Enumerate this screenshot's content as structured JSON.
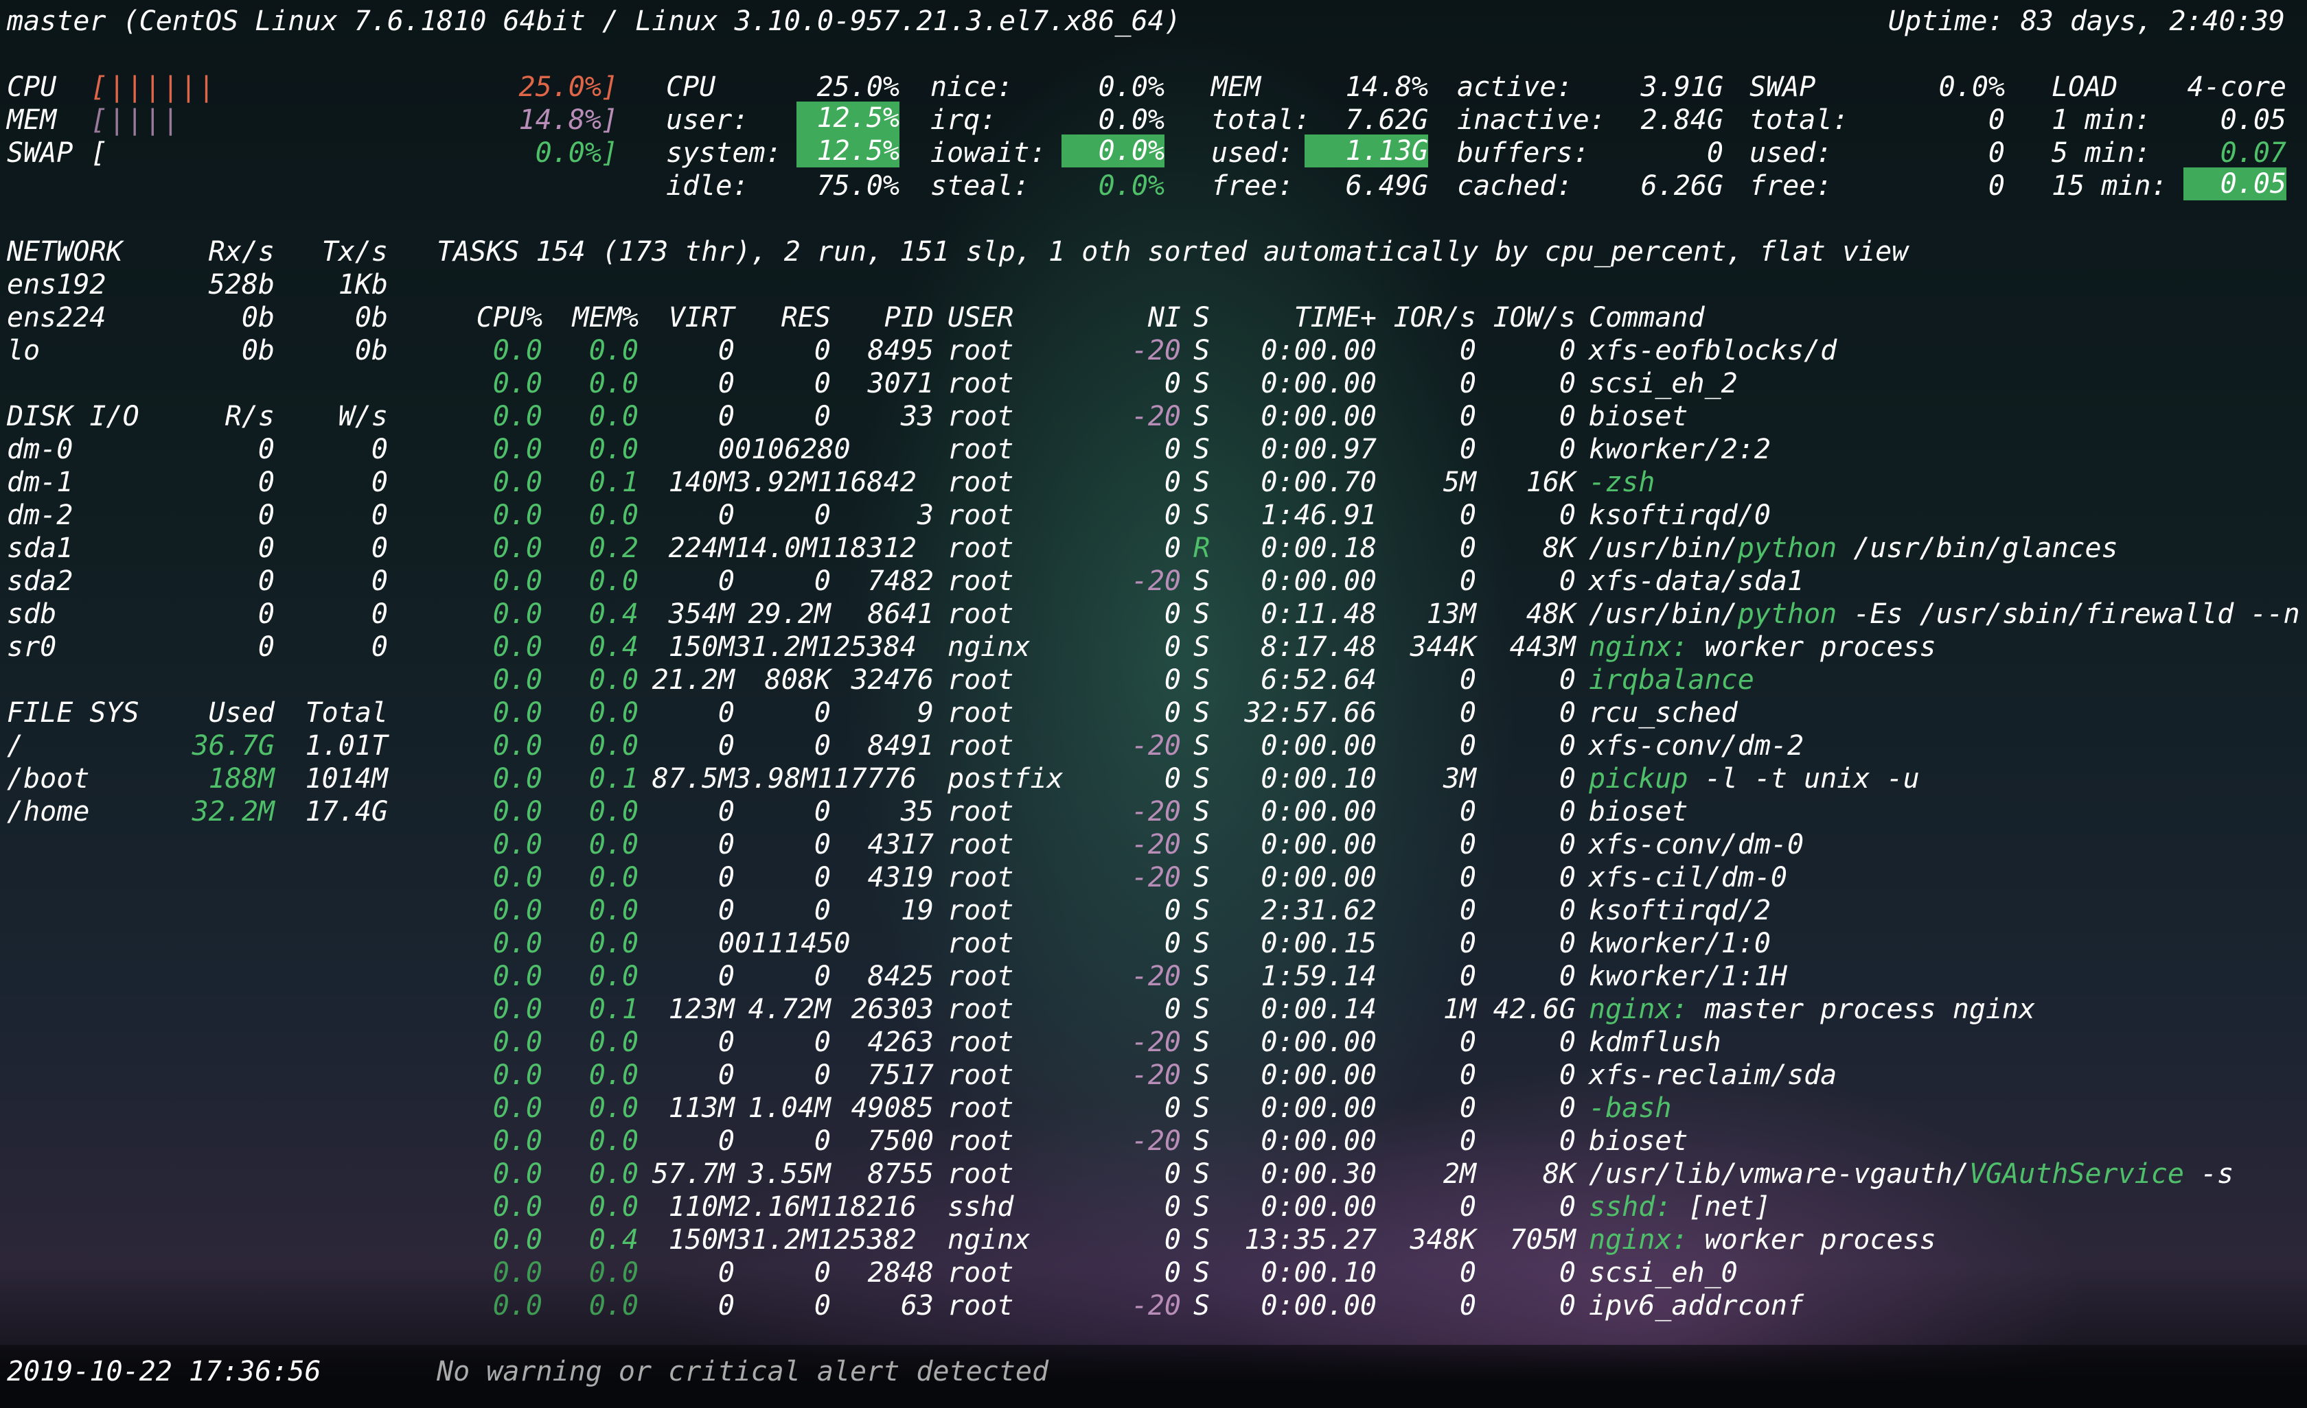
{
  "header": {
    "host": "master",
    "os": "(CentOS Linux 7.6.1810 64bit / Linux 3.10.0-957.21.3.el7.x86_64)",
    "uptime": "Uptime: 83 days, 2:40:39"
  },
  "quicklook": {
    "cpu_label": "CPU",
    "cpu_bar": "[||||||",
    "cpu_pct": "25.0%]",
    "mem_label": "MEM",
    "mem_bar": "[||||",
    "mem_pct": "14.8%]",
    "swap_label": "SWAP",
    "swap_bar": "[",
    "swap_pct": "0.0%]"
  },
  "cpu": {
    "title": "CPU",
    "total": "25.0%",
    "user_label": "user:",
    "user": "12.5%",
    "system_label": "system:",
    "system": "12.5%",
    "idle_label": "idle:",
    "idle": "75.0%",
    "nice_label": "nice:",
    "nice": "0.0%",
    "irq_label": "irq:",
    "irq": "0.0%",
    "iowait_label": "iowait:",
    "iowait": "0.0%",
    "steal_label": "steal:",
    "steal": "0.0%"
  },
  "mem": {
    "title": "MEM",
    "pct": "14.8%",
    "total_label": "total:",
    "total": "7.62G",
    "used_label": "used:",
    "used": "1.13G",
    "free_label": "free:",
    "free": "6.49G",
    "active_label": "active:",
    "active": "3.91G",
    "inactive_label": "inactive:",
    "inactive": "2.84G",
    "buffers_label": "buffers:",
    "buffers": "0",
    "cached_label": "cached:",
    "cached": "6.26G"
  },
  "swap": {
    "title": "SWAP",
    "pct": "0.0%",
    "total_label": "total:",
    "total": "0",
    "used_label": "used:",
    "used": "0",
    "free_label": "free:",
    "free": "0"
  },
  "load": {
    "title": "LOAD",
    "cores": "4-core",
    "m1_label": "1 min:",
    "m1": "0.05",
    "m5_label": "5 min:",
    "m5": "0.07",
    "m15_label": "15 min:",
    "m15": "0.05"
  },
  "network": {
    "title": "NETWORK",
    "rx_header": "Rx/s",
    "tx_header": "Tx/s",
    "rows": [
      {
        "name": "ens192",
        "rx": "528b",
        "tx": "1Kb"
      },
      {
        "name": "ens224",
        "rx": "0b",
        "tx": "0b"
      },
      {
        "name": "lo",
        "rx": "0b",
        "tx": "0b"
      }
    ]
  },
  "diskio": {
    "title": "DISK I/O",
    "r_header": "R/s",
    "w_header": "W/s",
    "rows": [
      {
        "name": "dm-0",
        "r": "0",
        "w": "0"
      },
      {
        "name": "dm-1",
        "r": "0",
        "w": "0"
      },
      {
        "name": "dm-2",
        "r": "0",
        "w": "0"
      },
      {
        "name": "sda1",
        "r": "0",
        "w": "0"
      },
      {
        "name": "sda2",
        "r": "0",
        "w": "0"
      },
      {
        "name": "sdb",
        "r": "0",
        "w": "0"
      },
      {
        "name": "sr0",
        "r": "0",
        "w": "0"
      }
    ]
  },
  "filesys": {
    "title": "FILE SYS",
    "used_header": "Used",
    "total_header": "Total",
    "rows": [
      {
        "name": "/",
        "used": "36.7G",
        "total": "1.01T"
      },
      {
        "name": "/boot",
        "used": "188M",
        "total": "1014M"
      },
      {
        "name": "/home",
        "used": "32.2M",
        "total": "17.4G"
      }
    ]
  },
  "tasks": {
    "summary": "TASKS 154 (173 thr), 2 run, 151 slp, 1 oth sorted automatically by cpu_percent, flat view"
  },
  "process_table": {
    "headers": {
      "cpu": "CPU%",
      "mem": "MEM%",
      "virt": "VIRT",
      "res": "RES",
      "pid": "PID",
      "user": "USER",
      "ni": "NI",
      "s": "S",
      "time": "TIME+",
      "ior": "IOR/s",
      "iow": "IOW/s",
      "cmd": "Command"
    },
    "rows": [
      {
        "cpu": "0.0",
        "mem": "0.0",
        "virt": "0",
        "res": "0",
        "pid": "8495",
        "user": "root",
        "ni": "-20",
        "s": "S",
        "time": "0:00.00",
        "ior": "0",
        "iow": "0",
        "cmd_pre": "",
        "cmd_hl": "",
        "cmd_post": "xfs-eofblocks/d"
      },
      {
        "cpu": "0.0",
        "mem": "0.0",
        "virt": "0",
        "res": "0",
        "pid": "3071",
        "user": "root",
        "ni": "0",
        "s": "S",
        "time": "0:00.00",
        "ior": "0",
        "iow": "0",
        "cmd_pre": "",
        "cmd_hl": "",
        "cmd_post": "scsi_eh_2"
      },
      {
        "cpu": "0.0",
        "mem": "0.0",
        "virt": "0",
        "res": "0",
        "pid": "33",
        "user": "root",
        "ni": "-20",
        "s": "S",
        "time": "0:00.00",
        "ior": "0",
        "iow": "0",
        "cmd_pre": "",
        "cmd_hl": "",
        "cmd_post": "bioset"
      },
      {
        "cpu": "0.0",
        "mem": "0.0",
        "virt": "0",
        "res": "0106280",
        "pid": "",
        "user": "root",
        "ni": "0",
        "s": "S",
        "time": "0:00.97",
        "ior": "0",
        "iow": "0",
        "cmd_pre": "",
        "cmd_hl": "",
        "cmd_post": "kworker/2:2"
      },
      {
        "cpu": "0.0",
        "mem": "0.1",
        "virt": "140M",
        "res": "3.92M116842",
        "pid": "",
        "user": "root",
        "ni": "0",
        "s": "S",
        "time": "0:00.70",
        "ior": "5M",
        "iow": "16K",
        "cmd_pre": "",
        "cmd_hl": "-zsh",
        "cmd_post": ""
      },
      {
        "cpu": "0.0",
        "mem": "0.0",
        "virt": "0",
        "res": "0",
        "pid": "3",
        "user": "root",
        "ni": "0",
        "s": "S",
        "time": "1:46.91",
        "ior": "0",
        "iow": "0",
        "cmd_pre": "",
        "cmd_hl": "",
        "cmd_post": "ksoftirqd/0"
      },
      {
        "cpu": "0.0",
        "mem": "0.2",
        "virt": "224M",
        "res": "14.0M118312",
        "pid": "",
        "user": "root",
        "ni": "0",
        "s": "R",
        "time": "0:00.18",
        "ior": "0",
        "iow": "8K",
        "cmd_pre": "/usr/bin/",
        "cmd_hl": "python",
        "cmd_post": " /usr/bin/glances"
      },
      {
        "cpu": "0.0",
        "mem": "0.0",
        "virt": "0",
        "res": "0",
        "pid": "7482",
        "user": "root",
        "ni": "-20",
        "s": "S",
        "time": "0:00.00",
        "ior": "0",
        "iow": "0",
        "cmd_pre": "",
        "cmd_hl": "",
        "cmd_post": "xfs-data/sda1"
      },
      {
        "cpu": "0.0",
        "mem": "0.4",
        "virt": "354M",
        "res": "29.2M",
        "pid": "8641",
        "user": "root",
        "ni": "0",
        "s": "S",
        "time": "0:11.48",
        "ior": "13M",
        "iow": "48K",
        "cmd_pre": "/usr/bin/",
        "cmd_hl": "python",
        "cmd_post": " -Es /usr/sbin/firewalld --n"
      },
      {
        "cpu": "0.0",
        "mem": "0.4",
        "virt": "150M",
        "res": "31.2M125384",
        "pid": "",
        "user": "nginx",
        "ni": "0",
        "s": "S",
        "time": "8:17.48",
        "ior": "344K",
        "iow": "443M",
        "cmd_pre": "",
        "cmd_hl": "nginx:",
        "cmd_post": " worker process"
      },
      {
        "cpu": "0.0",
        "mem": "0.0",
        "virt": "21.2M",
        "res": "808K",
        "pid": "32476",
        "user": "root",
        "ni": "0",
        "s": "S",
        "time": "6:52.64",
        "ior": "0",
        "iow": "0",
        "cmd_pre": "",
        "cmd_hl": "irqbalance",
        "cmd_post": ""
      },
      {
        "cpu": "0.0",
        "mem": "0.0",
        "virt": "0",
        "res": "0",
        "pid": "9",
        "user": "root",
        "ni": "0",
        "s": "S",
        "time": "32:57.66",
        "ior": "0",
        "iow": "0",
        "cmd_pre": "",
        "cmd_hl": "",
        "cmd_post": "rcu_sched"
      },
      {
        "cpu": "0.0",
        "mem": "0.0",
        "virt": "0",
        "res": "0",
        "pid": "8491",
        "user": "root",
        "ni": "-20",
        "s": "S",
        "time": "0:00.00",
        "ior": "0",
        "iow": "0",
        "cmd_pre": "",
        "cmd_hl": "",
        "cmd_post": "xfs-conv/dm-2"
      },
      {
        "cpu": "0.0",
        "mem": "0.1",
        "virt": "87.5M",
        "res": "3.98M117776",
        "pid": "",
        "user": "postfix",
        "ni": "0",
        "s": "S",
        "time": "0:00.10",
        "ior": "3M",
        "iow": "0",
        "cmd_pre": "",
        "cmd_hl": "pickup",
        "cmd_post": " -l -t unix -u"
      },
      {
        "cpu": "0.0",
        "mem": "0.0",
        "virt": "0",
        "res": "0",
        "pid": "35",
        "user": "root",
        "ni": "-20",
        "s": "S",
        "time": "0:00.00",
        "ior": "0",
        "iow": "0",
        "cmd_pre": "",
        "cmd_hl": "",
        "cmd_post": "bioset"
      },
      {
        "cpu": "0.0",
        "mem": "0.0",
        "virt": "0",
        "res": "0",
        "pid": "4317",
        "user": "root",
        "ni": "-20",
        "s": "S",
        "time": "0:00.00",
        "ior": "0",
        "iow": "0",
        "cmd_pre": "",
        "cmd_hl": "",
        "cmd_post": "xfs-conv/dm-0"
      },
      {
        "cpu": "0.0",
        "mem": "0.0",
        "virt": "0",
        "res": "0",
        "pid": "4319",
        "user": "root",
        "ni": "-20",
        "s": "S",
        "time": "0:00.00",
        "ior": "0",
        "iow": "0",
        "cmd_pre": "",
        "cmd_hl": "",
        "cmd_post": "xfs-cil/dm-0"
      },
      {
        "cpu": "0.0",
        "mem": "0.0",
        "virt": "0",
        "res": "0",
        "pid": "19",
        "user": "root",
        "ni": "0",
        "s": "S",
        "time": "2:31.62",
        "ior": "0",
        "iow": "0",
        "cmd_pre": "",
        "cmd_hl": "",
        "cmd_post": "ksoftirqd/2"
      },
      {
        "cpu": "0.0",
        "mem": "0.0",
        "virt": "0",
        "res": "0111450",
        "pid": "",
        "user": "root",
        "ni": "0",
        "s": "S",
        "time": "0:00.15",
        "ior": "0",
        "iow": "0",
        "cmd_pre": "",
        "cmd_hl": "",
        "cmd_post": "kworker/1:0"
      },
      {
        "cpu": "0.0",
        "mem": "0.0",
        "virt": "0",
        "res": "0",
        "pid": "8425",
        "user": "root",
        "ni": "-20",
        "s": "S",
        "time": "1:59.14",
        "ior": "0",
        "iow": "0",
        "cmd_pre": "",
        "cmd_hl": "",
        "cmd_post": "kworker/1:1H"
      },
      {
        "cpu": "0.0",
        "mem": "0.1",
        "virt": "123M",
        "res": "4.72M",
        "pid": "26303",
        "user": "root",
        "ni": "0",
        "s": "S",
        "time": "0:00.14",
        "ior": "1M",
        "iow": "42.6G",
        "cmd_pre": "",
        "cmd_hl": "nginx:",
        "cmd_post": " master process nginx"
      },
      {
        "cpu": "0.0",
        "mem": "0.0",
        "virt": "0",
        "res": "0",
        "pid": "4263",
        "user": "root",
        "ni": "-20",
        "s": "S",
        "time": "0:00.00",
        "ior": "0",
        "iow": "0",
        "cmd_pre": "",
        "cmd_hl": "",
        "cmd_post": "kdmflush"
      },
      {
        "cpu": "0.0",
        "mem": "0.0",
        "virt": "0",
        "res": "0",
        "pid": "7517",
        "user": "root",
        "ni": "-20",
        "s": "S",
        "time": "0:00.00",
        "ior": "0",
        "iow": "0",
        "cmd_pre": "",
        "cmd_hl": "",
        "cmd_post": "xfs-reclaim/sda"
      },
      {
        "cpu": "0.0",
        "mem": "0.0",
        "virt": "113M",
        "res": "1.04M",
        "pid": "49085",
        "user": "root",
        "ni": "0",
        "s": "S",
        "time": "0:00.00",
        "ior": "0",
        "iow": "0",
        "cmd_pre": "",
        "cmd_hl": "-bash",
        "cmd_post": ""
      },
      {
        "cpu": "0.0",
        "mem": "0.0",
        "virt": "0",
        "res": "0",
        "pid": "7500",
        "user": "root",
        "ni": "-20",
        "s": "S",
        "time": "0:00.00",
        "ior": "0",
        "iow": "0",
        "cmd_pre": "",
        "cmd_hl": "",
        "cmd_post": "bioset"
      },
      {
        "cpu": "0.0",
        "mem": "0.0",
        "virt": "57.7M",
        "res": "3.55M",
        "pid": "8755",
        "user": "root",
        "ni": "0",
        "s": "S",
        "time": "0:00.30",
        "ior": "2M",
        "iow": "8K",
        "cmd_pre": "/usr/lib/vmware-vgauth/",
        "cmd_hl": "VGAuthService",
        "cmd_post": " -s"
      },
      {
        "cpu": "0.0",
        "mem": "0.0",
        "virt": "110M",
        "res": "2.16M118216",
        "pid": "",
        "user": "sshd",
        "ni": "0",
        "s": "S",
        "time": "0:00.00",
        "ior": "0",
        "iow": "0",
        "cmd_pre": "",
        "cmd_hl": "sshd:",
        "cmd_post": " [net]"
      },
      {
        "cpu": "0.0",
        "mem": "0.4",
        "virt": "150M",
        "res": "31.2M125382",
        "pid": "",
        "user": "nginx",
        "ni": "0",
        "s": "S",
        "time": "13:35.27",
        "ior": "348K",
        "iow": "705M",
        "cmd_pre": "",
        "cmd_hl": "nginx:",
        "cmd_post": " worker process"
      },
      {
        "cpu": "0.0",
        "mem": "0.0",
        "virt": "0",
        "res": "0",
        "pid": "2848",
        "user": "root",
        "ni": "0",
        "s": "S",
        "time": "0:00.10",
        "ior": "0",
        "iow": "0",
        "cmd_pre": "",
        "cmd_hl": "",
        "cmd_post": "scsi_eh_0"
      },
      {
        "cpu": "0.0",
        "mem": "0.0",
        "virt": "0",
        "res": "0",
        "pid": "63",
        "user": "root",
        "ni": "-20",
        "s": "S",
        "time": "0:00.00",
        "ior": "0",
        "iow": "0",
        "cmd_pre": "",
        "cmd_hl": "",
        "cmd_post": "ipv6_addrconf"
      }
    ]
  },
  "footer": {
    "datetime": "2019-10-22 17:36:56",
    "alert": "No warning or critical alert detected"
  },
  "colors": {
    "ok_green": "#4fbf6a",
    "highlight_bg": "#3faa5a",
    "nice_magenta": "#b88db8",
    "cpu_orange": "#e0664a"
  }
}
